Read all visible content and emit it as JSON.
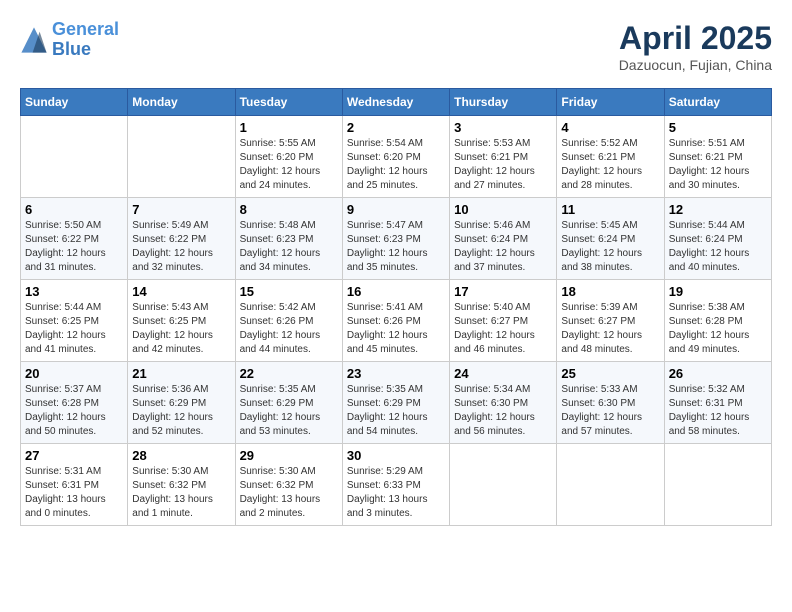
{
  "logo": {
    "line1": "General",
    "line2": "Blue"
  },
  "title": "April 2025",
  "location": "Dazuocun, Fujian, China",
  "days_of_week": [
    "Sunday",
    "Monday",
    "Tuesday",
    "Wednesday",
    "Thursday",
    "Friday",
    "Saturday"
  ],
  "weeks": [
    [
      {
        "day": "",
        "info": ""
      },
      {
        "day": "",
        "info": ""
      },
      {
        "day": "1",
        "info": "Sunrise: 5:55 AM\nSunset: 6:20 PM\nDaylight: 12 hours and 24 minutes."
      },
      {
        "day": "2",
        "info": "Sunrise: 5:54 AM\nSunset: 6:20 PM\nDaylight: 12 hours and 25 minutes."
      },
      {
        "day": "3",
        "info": "Sunrise: 5:53 AM\nSunset: 6:21 PM\nDaylight: 12 hours and 27 minutes."
      },
      {
        "day": "4",
        "info": "Sunrise: 5:52 AM\nSunset: 6:21 PM\nDaylight: 12 hours and 28 minutes."
      },
      {
        "day": "5",
        "info": "Sunrise: 5:51 AM\nSunset: 6:21 PM\nDaylight: 12 hours and 30 minutes."
      }
    ],
    [
      {
        "day": "6",
        "info": "Sunrise: 5:50 AM\nSunset: 6:22 PM\nDaylight: 12 hours and 31 minutes."
      },
      {
        "day": "7",
        "info": "Sunrise: 5:49 AM\nSunset: 6:22 PM\nDaylight: 12 hours and 32 minutes."
      },
      {
        "day": "8",
        "info": "Sunrise: 5:48 AM\nSunset: 6:23 PM\nDaylight: 12 hours and 34 minutes."
      },
      {
        "day": "9",
        "info": "Sunrise: 5:47 AM\nSunset: 6:23 PM\nDaylight: 12 hours and 35 minutes."
      },
      {
        "day": "10",
        "info": "Sunrise: 5:46 AM\nSunset: 6:24 PM\nDaylight: 12 hours and 37 minutes."
      },
      {
        "day": "11",
        "info": "Sunrise: 5:45 AM\nSunset: 6:24 PM\nDaylight: 12 hours and 38 minutes."
      },
      {
        "day": "12",
        "info": "Sunrise: 5:44 AM\nSunset: 6:24 PM\nDaylight: 12 hours and 40 minutes."
      }
    ],
    [
      {
        "day": "13",
        "info": "Sunrise: 5:44 AM\nSunset: 6:25 PM\nDaylight: 12 hours and 41 minutes."
      },
      {
        "day": "14",
        "info": "Sunrise: 5:43 AM\nSunset: 6:25 PM\nDaylight: 12 hours and 42 minutes."
      },
      {
        "day": "15",
        "info": "Sunrise: 5:42 AM\nSunset: 6:26 PM\nDaylight: 12 hours and 44 minutes."
      },
      {
        "day": "16",
        "info": "Sunrise: 5:41 AM\nSunset: 6:26 PM\nDaylight: 12 hours and 45 minutes."
      },
      {
        "day": "17",
        "info": "Sunrise: 5:40 AM\nSunset: 6:27 PM\nDaylight: 12 hours and 46 minutes."
      },
      {
        "day": "18",
        "info": "Sunrise: 5:39 AM\nSunset: 6:27 PM\nDaylight: 12 hours and 48 minutes."
      },
      {
        "day": "19",
        "info": "Sunrise: 5:38 AM\nSunset: 6:28 PM\nDaylight: 12 hours and 49 minutes."
      }
    ],
    [
      {
        "day": "20",
        "info": "Sunrise: 5:37 AM\nSunset: 6:28 PM\nDaylight: 12 hours and 50 minutes."
      },
      {
        "day": "21",
        "info": "Sunrise: 5:36 AM\nSunset: 6:29 PM\nDaylight: 12 hours and 52 minutes."
      },
      {
        "day": "22",
        "info": "Sunrise: 5:35 AM\nSunset: 6:29 PM\nDaylight: 12 hours and 53 minutes."
      },
      {
        "day": "23",
        "info": "Sunrise: 5:35 AM\nSunset: 6:29 PM\nDaylight: 12 hours and 54 minutes."
      },
      {
        "day": "24",
        "info": "Sunrise: 5:34 AM\nSunset: 6:30 PM\nDaylight: 12 hours and 56 minutes."
      },
      {
        "day": "25",
        "info": "Sunrise: 5:33 AM\nSunset: 6:30 PM\nDaylight: 12 hours and 57 minutes."
      },
      {
        "day": "26",
        "info": "Sunrise: 5:32 AM\nSunset: 6:31 PM\nDaylight: 12 hours and 58 minutes."
      }
    ],
    [
      {
        "day": "27",
        "info": "Sunrise: 5:31 AM\nSunset: 6:31 PM\nDaylight: 13 hours and 0 minutes."
      },
      {
        "day": "28",
        "info": "Sunrise: 5:30 AM\nSunset: 6:32 PM\nDaylight: 13 hours and 1 minute."
      },
      {
        "day": "29",
        "info": "Sunrise: 5:30 AM\nSunset: 6:32 PM\nDaylight: 13 hours and 2 minutes."
      },
      {
        "day": "30",
        "info": "Sunrise: 5:29 AM\nSunset: 6:33 PM\nDaylight: 13 hours and 3 minutes."
      },
      {
        "day": "",
        "info": ""
      },
      {
        "day": "",
        "info": ""
      },
      {
        "day": "",
        "info": ""
      }
    ]
  ]
}
